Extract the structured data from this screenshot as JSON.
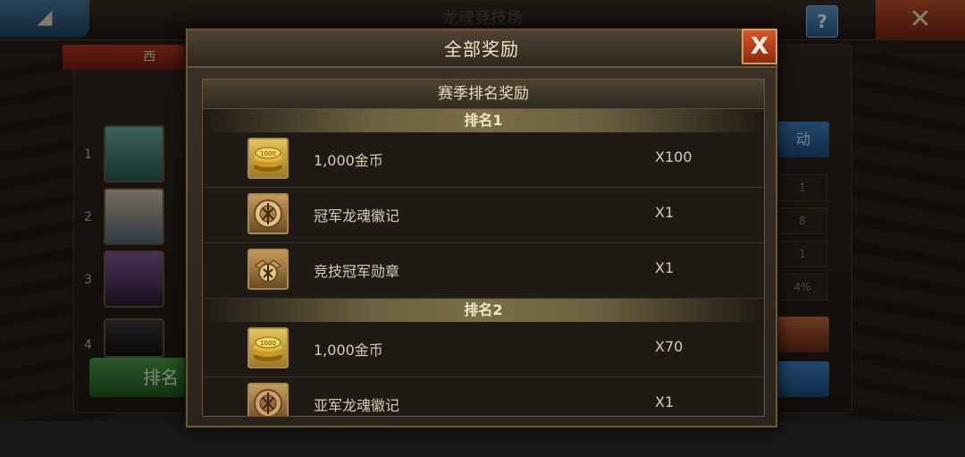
{
  "background": {
    "title": "龙魂竞技场",
    "back_glyph": "◢",
    "help_label": "?",
    "close_label": "✕",
    "tab_label": "西",
    "ranks": [
      "1",
      "2",
      "3",
      "4"
    ],
    "button_label": "排名",
    "side_values": [
      "1",
      "8",
      "1",
      "4%"
    ],
    "blue_button_label": "动"
  },
  "modal": {
    "title": "全部奖励",
    "close_label": "X",
    "section_title": "赛季排名奖励",
    "groups": [
      {
        "rank_label": "排名1",
        "items": [
          {
            "name": "1,000金币",
            "qty": "X100",
            "icon": "gold-coins-icon"
          },
          {
            "name": "冠军龙魂徽记",
            "qty": "X1",
            "icon": "champion-emblem-icon"
          },
          {
            "name": "竞技冠军勋章",
            "qty": "X1",
            "icon": "champion-medal-icon"
          }
        ]
      },
      {
        "rank_label": "排名2",
        "items": [
          {
            "name": "1,000金币",
            "qty": "X70",
            "icon": "gold-coins-icon"
          },
          {
            "name": "亚军龙魂徽记",
            "qty": "X1",
            "icon": "runner-up-emblem-icon"
          }
        ]
      }
    ]
  },
  "colors": {
    "gold": "#e6c25a",
    "bronze": "#c89a5a",
    "close_red": "#d9542a"
  }
}
